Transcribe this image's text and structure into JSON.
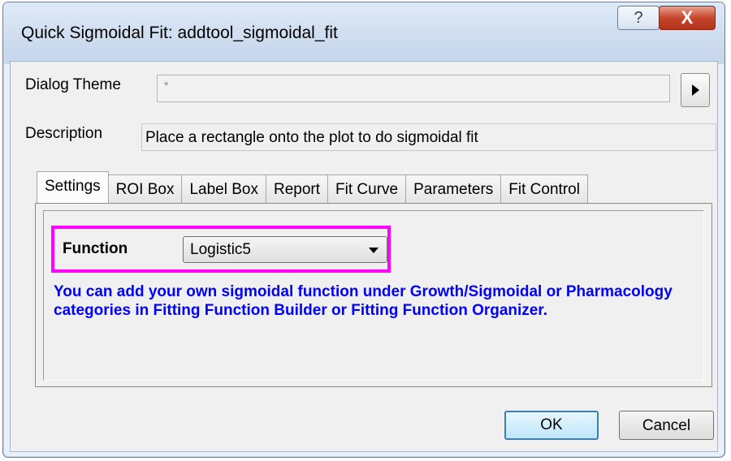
{
  "window": {
    "title": "Quick Sigmoidal Fit: addtool_sigmoidal_fit",
    "help_glyph": "?",
    "close_glyph": "X"
  },
  "dialog_theme": {
    "label": "Dialog Theme",
    "value": "*",
    "menu_icon": "right-triangle-icon"
  },
  "description": {
    "label": "Description",
    "value": "Place a rectangle onto the plot to do sigmoidal fit"
  },
  "tabs": [
    {
      "label": "Settings",
      "active": true
    },
    {
      "label": "ROI Box",
      "active": false
    },
    {
      "label": "Label Box",
      "active": false
    },
    {
      "label": "Report",
      "active": false
    },
    {
      "label": "Fit Curve",
      "active": false
    },
    {
      "label": "Parameters",
      "active": false
    },
    {
      "label": "Fit Control",
      "active": false
    }
  ],
  "settings": {
    "function_label": "Function",
    "function_value": "Logistic5",
    "info_text": "You can add your own sigmoidal function under Growth/Sigmoidal or Pharmacology categories in Fitting Function Builder or Fitting Function Organizer.",
    "highlight_color": "#ff00ff",
    "info_color": "#0000ff"
  },
  "buttons": {
    "ok": "OK",
    "cancel": "Cancel"
  }
}
